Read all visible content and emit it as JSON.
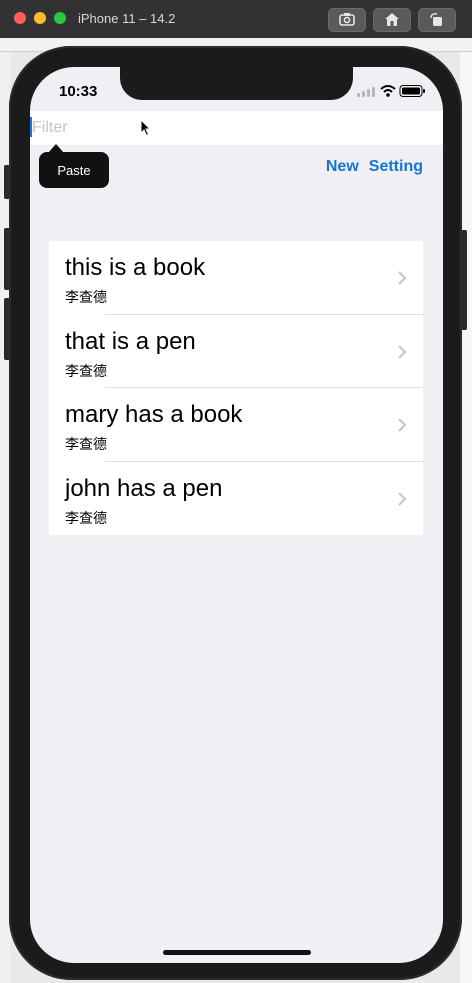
{
  "window": {
    "title": "iPhone 11 – 14.2"
  },
  "status_bar": {
    "time": "10:33"
  },
  "filter": {
    "placeholder": "Filter",
    "value": ""
  },
  "context_menu": {
    "paste_label": "Paste"
  },
  "nav": {
    "new_label": "New",
    "setting_label": "Setting"
  },
  "items": [
    {
      "title": "this is a book",
      "author": "李查德"
    },
    {
      "title": "that is a pen",
      "author": "李查德"
    },
    {
      "title": "mary has a book",
      "author": "李查德"
    },
    {
      "title": "john has a pen",
      "author": "李查德"
    }
  ],
  "icons": [
    "screenshot-icon",
    "home-icon",
    "rotate-icon",
    "signal-icon",
    "wifi-icon",
    "battery-icon",
    "chevron-right-icon",
    "mouse-pointer-icon"
  ],
  "colors": {
    "accent": "#1575d3",
    "background": "#efeff4",
    "chrome": "#323234"
  }
}
